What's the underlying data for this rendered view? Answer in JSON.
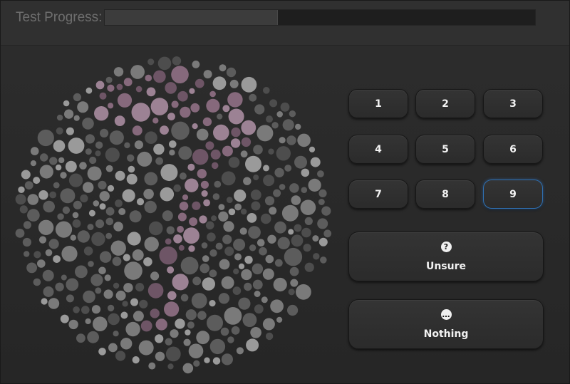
{
  "header": {
    "progress_label": "Test Progress:",
    "progress_fraction": 0.4
  },
  "plate": {
    "icon": "ishihara-plate",
    "colors": {
      "gray_dark": "#4d4d4d",
      "gray_mid": "#5c5c5c",
      "gray_light": "#7a7a7a",
      "gray_pale": "#9a9a9a",
      "pink_dark": "#6e5566",
      "pink_mid": "#86697c",
      "pink_light": "#9c8294"
    }
  },
  "answers": {
    "digits": [
      {
        "label": "1",
        "name": "answer-1-button"
      },
      {
        "label": "2",
        "name": "answer-2-button"
      },
      {
        "label": "3",
        "name": "answer-3-button"
      },
      {
        "label": "4",
        "name": "answer-4-button"
      },
      {
        "label": "5",
        "name": "answer-5-button"
      },
      {
        "label": "6",
        "name": "answer-6-button"
      },
      {
        "label": "7",
        "name": "answer-7-button"
      },
      {
        "label": "8",
        "name": "answer-8-button"
      },
      {
        "label": "9",
        "name": "answer-9-button"
      }
    ],
    "selected": "9",
    "unsure": {
      "icon_glyph": "?",
      "icon": "question-icon",
      "label": "Unsure"
    },
    "nothing": {
      "icon_glyph": "…",
      "icon": "ellipsis-icon",
      "label": "Nothing"
    }
  }
}
